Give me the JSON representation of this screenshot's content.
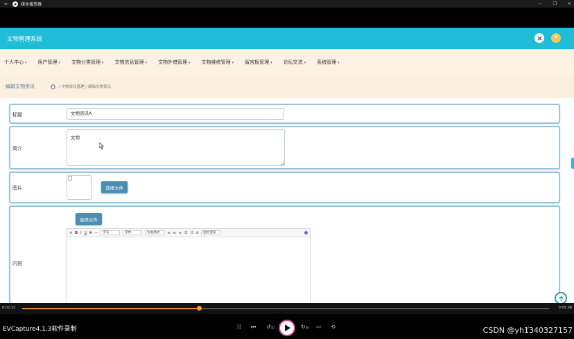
{
  "player": {
    "window_title": "媒体播放器",
    "back_glyph": "←",
    "win_min": "—",
    "win_restore": "❐",
    "win_close": "✕",
    "time_current": "0:02:32",
    "time_total": "0:05:08",
    "progress_fraction": 0.335,
    "brand": "EVCapture4.1.3软件录制",
    "watermark": "CSDN @yh1340327157",
    "controls": {
      "shuffle": "⤨",
      "prev": "⏮",
      "rewind": "↺",
      "rewind_label": "10",
      "forward": "↻",
      "forward_label": "30",
      "next": "⏭",
      "repeat": "⟲"
    },
    "right_ctrls": [
      "▭",
      "⤢",
      "⋯"
    ]
  },
  "app": {
    "title": "文物管理系统",
    "accent_color": "#1fbdd7",
    "nav": [
      {
        "label": "个人中心"
      },
      {
        "label": "用户管理"
      },
      {
        "label": "文物分类管理"
      },
      {
        "label": "文物信息管理"
      },
      {
        "label": "文物外借管理"
      },
      {
        "label": "文物维修管理"
      },
      {
        "label": "留言板管理"
      },
      {
        "label": "论坛交流"
      },
      {
        "label": "系统管理"
      }
    ],
    "nav_caret": "▾",
    "page_title": "编辑文物资讯",
    "breadcrumb": "/ 文物资讯管理 / 编辑文物资讯"
  },
  "form": {
    "title_label": "标题",
    "title_value": "文物资讯A",
    "intro_label": "简介",
    "intro_value": "文物",
    "image_label": "图片",
    "image_button": "选择文件",
    "content_label": "内容",
    "content_button": "选择文件",
    "editor_toolbar": {
      "undo": "⟲",
      "bold": "B",
      "italic": "I",
      "underline": "U",
      "strike": "S",
      "minus": "—",
      "font_size": "字号",
      "font_family": "字体",
      "format": "标准格式",
      "align": "≡",
      "align_center": "≡",
      "align_right": "≡",
      "list": "☰",
      "list_ordered": "☷",
      "color": "A",
      "text_style": "图文混排"
    }
  }
}
